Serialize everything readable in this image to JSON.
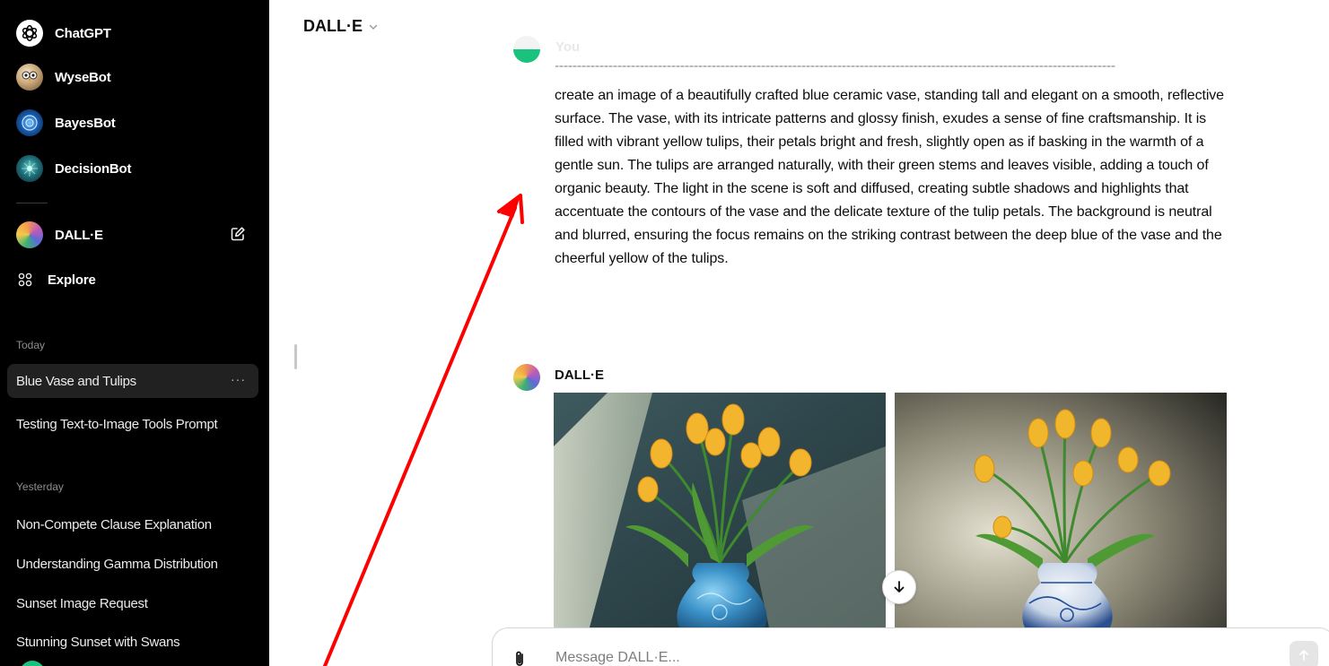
{
  "sidebar": {
    "gpts": [
      {
        "label": "ChatGPT",
        "icon": "openai-logo-icon"
      },
      {
        "label": "WyseBot",
        "icon": "owl-avatar-icon"
      },
      {
        "label": "BayesBot",
        "icon": "bayesbot-avatar-icon"
      },
      {
        "label": "DecisionBot",
        "icon": "decisionbot-avatar-icon"
      },
      {
        "label": "DALL·E",
        "icon": "dalle-avatar-icon"
      },
      {
        "label": "Explore",
        "icon": "grid-icon"
      }
    ],
    "sections": [
      {
        "label": "Today",
        "chats": [
          "Blue Vase and Tulips",
          "Testing Text-to-Image Tools Prompt"
        ]
      },
      {
        "label": "Yesterday",
        "chats": [
          "Non-Compete Clause Explanation",
          "Understanding Gamma Distribution",
          "Sunset Image Request",
          "Stunning Sunset with Swans"
        ]
      }
    ],
    "active_chat_index": 0
  },
  "header": {
    "title": "DALL·E"
  },
  "conversation": {
    "user": {
      "name": "You"
    },
    "prompt": "create an image of a beautifully crafted blue ceramic vase, standing tall and elegant on a smooth, reflective surface. The vase, with its intricate patterns and glossy finish, exudes a sense of fine craftsmanship. It is filled with vibrant yellow tulips, their petals bright and fresh, slightly open as if basking in the warmth of a gentle sun. The tulips are arranged naturally, with their green stems and leaves visible, adding a touch of organic beauty. The light in the scene is soft and diffused, creating subtle shadows and highlights that accentuate the contours of the vase and the delicate texture of the tulip petals. The background is neutral and blurred, ensuring the focus remains on the striking contrast between the deep blue of the vase and the cheerful yellow of the tulips.",
    "bot": {
      "name": "DALL·E"
    }
  },
  "composer": {
    "placeholder": "Message DALL·E..."
  },
  "colors": {
    "sidebar_bg": "#000000",
    "active_chat_bg": "#212121",
    "annotation_arrow": "#ff0000"
  }
}
